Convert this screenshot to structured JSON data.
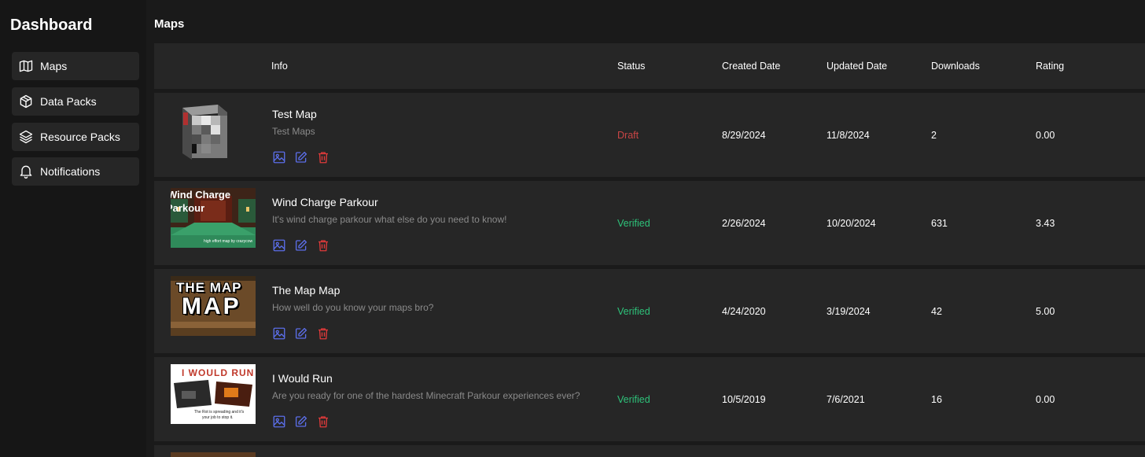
{
  "sidebar": {
    "title": "Dashboard",
    "items": [
      {
        "label": "Maps",
        "icon": "map-icon"
      },
      {
        "label": "Data Packs",
        "icon": "box-icon"
      },
      {
        "label": "Resource Packs",
        "icon": "layers-icon"
      },
      {
        "label": "Notifications",
        "icon": "bell-icon"
      }
    ]
  },
  "main": {
    "title": "Maps",
    "columns": {
      "info": "Info",
      "status": "Status",
      "created": "Created Date",
      "updated": "Updated Date",
      "downloads": "Downloads",
      "rating": "Rating"
    },
    "rows": [
      {
        "title": "Test Map",
        "description": "Test Maps",
        "status": "Draft",
        "created": "8/29/2024",
        "updated": "11/8/2024",
        "downloads": "2",
        "rating": "0.00"
      },
      {
        "title": "Wind Charge Parkour",
        "description": "It's wind charge parkour what else do you need to know!",
        "status": "Verified",
        "created": "2/26/2024",
        "updated": "10/20/2024",
        "downloads": "631",
        "rating": "3.43",
        "thumb_text": [
          "Wind Charge",
          "Parkour",
          "high effort map by crazycow"
        ]
      },
      {
        "title": "The Map Map",
        "description": "How well do you know your maps bro?",
        "status": "Verified",
        "created": "4/24/2020",
        "updated": "3/19/2024",
        "downloads": "42",
        "rating": "5.00",
        "thumb_text": [
          "THE MAP",
          "MAP"
        ]
      },
      {
        "title": "I Would Run",
        "description": "Are you ready for one of the hardest Minecraft Parkour experiences ever?",
        "status": "Verified",
        "created": "10/5/2019",
        "updated": "7/6/2021",
        "downloads": "16",
        "rating": "0.00",
        "thumb_text": [
          "I WOULD RUN",
          "The Rot is spreading and it's",
          "your job to stop it."
        ]
      }
    ]
  },
  "colors": {
    "draft": "#c94545",
    "verified": "#2ec27a",
    "action_blue": "#5b6ee8",
    "action_red": "#e03a3a"
  }
}
